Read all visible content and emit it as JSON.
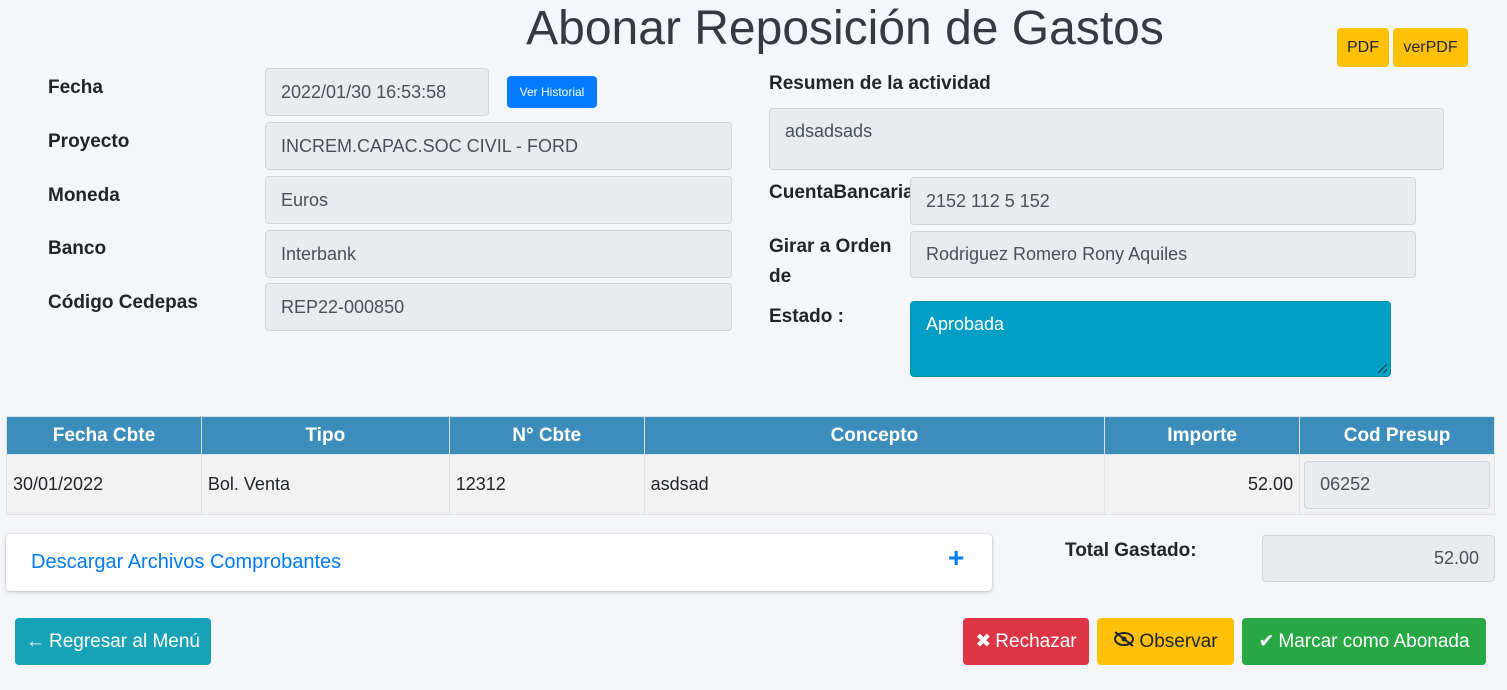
{
  "page": {
    "title": "Abonar Reposición de Gastos"
  },
  "pdf_buttons": {
    "pdf": "PDF",
    "verpdf": "verPDF"
  },
  "left_form": {
    "fecha_label": "Fecha",
    "fecha_value": "2022/01/30 16:53:58",
    "ver_historial": "Ver Historial",
    "proyecto_label": "Proyecto",
    "proyecto_value": "INCREM.CAPAC.SOC CIVIL - FORD",
    "moneda_label": "Moneda",
    "moneda_value": "Euros",
    "banco_label": "Banco",
    "banco_value": "Interbank",
    "codigo_label": "Código Cedepas",
    "codigo_value": "REP22-000850"
  },
  "right_form": {
    "resumen_label": "Resumen de la actividad",
    "resumen_value": "adsadsads",
    "cuenta_label": "CuentaBancaria",
    "cuenta_value": "2152 112 5 152",
    "girar_label_1": "Girar a Orden",
    "girar_label_2": "de",
    "girar_value": "Rodriguez Romero Rony Aquiles",
    "estado_label": "Estado :",
    "estado_value": "Aprobada"
  },
  "table": {
    "headers": [
      "Fecha Cbte",
      "Tipo",
      "N° Cbte",
      "Concepto",
      "Importe",
      "Cod Presup"
    ],
    "rows": [
      {
        "fecha": "30/01/2022",
        "tipo": "Bol. Venta",
        "numero": "12312",
        "concepto": "asdsad",
        "importe": "52.00",
        "cod_presup": "06252"
      }
    ]
  },
  "archivos": {
    "label": "Descargar Archivos Comprobantes",
    "icon": "plus-icon"
  },
  "total": {
    "label": "Total Gastado:",
    "value": "52.00"
  },
  "actions": {
    "regresar": "Regresar al Menú",
    "rechazar": "Rechazar",
    "observar": "Observar",
    "abonada": "Marcar como Abonada"
  },
  "colors": {
    "warning": "#ffc107",
    "primary": "#007bff",
    "info": "#17a2b8",
    "danger": "#dc3545",
    "success": "#28a745",
    "table_header": "#3c8dbc",
    "estado": "#00a0c6"
  }
}
